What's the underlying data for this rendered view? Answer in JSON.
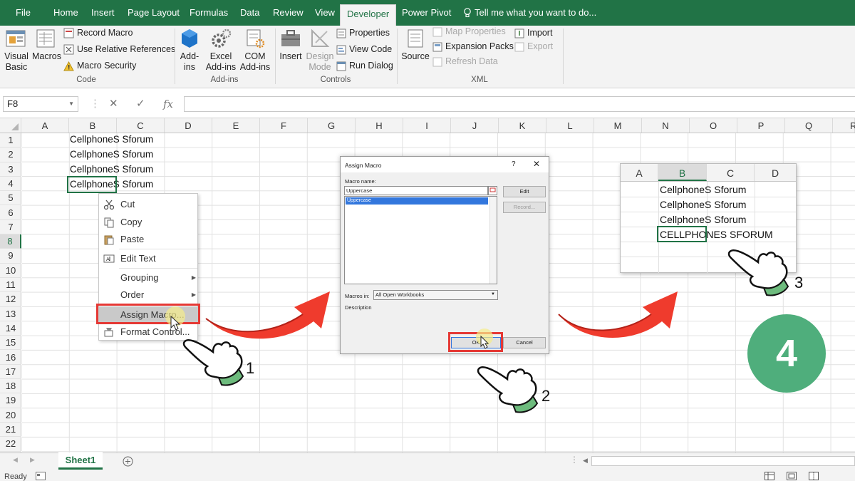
{
  "ribbon": {
    "tabs": [
      "File",
      "Home",
      "Insert",
      "Page Layout",
      "Formulas",
      "Data",
      "Review",
      "View",
      "Developer",
      "Power Pivot"
    ],
    "active_tab": "Developer",
    "tell_me": "Tell me what you want to do...",
    "code": {
      "visual_basic": "Visual Basic",
      "macros": "Macros",
      "record_macro": "Record Macro",
      "use_relative": "Use Relative References",
      "macro_security": "Macro Security",
      "label": "Code"
    },
    "addins": {
      "addins": "Add-ins",
      "excel_addins": "Excel Add-ins",
      "com_addins": "COM Add-ins",
      "label": "Add-ins"
    },
    "controls": {
      "insert": "Insert",
      "design_mode": "Design Mode",
      "properties": "Properties",
      "view_code": "View Code",
      "run_dialog": "Run Dialog",
      "label": "Controls"
    },
    "xml": {
      "source": "Source",
      "map_properties": "Map Properties",
      "expansion_packs": "Expansion Packs",
      "refresh_data": "Refresh Data",
      "import": "Import",
      "export": "Export",
      "label": "XML"
    }
  },
  "formula_bar": {
    "name_box": "F8",
    "fx": "fx"
  },
  "grid": {
    "columns": [
      "A",
      "B",
      "C",
      "D",
      "E",
      "F",
      "G",
      "H",
      "I",
      "J",
      "K",
      "L",
      "M",
      "N",
      "O",
      "P",
      "Q",
      "R"
    ],
    "rows": [
      "1",
      "2",
      "3",
      "4",
      "5",
      "6",
      "7",
      "8",
      "9",
      "10",
      "11",
      "12",
      "13",
      "14",
      "15",
      "16",
      "17",
      "18",
      "19",
      "20",
      "21",
      "22"
    ],
    "b_values": [
      "CellphoneS Sforum",
      "CellphoneS Sforum",
      "CellphoneS Sforum",
      "CellphoneS Sforum"
    ]
  },
  "context_menu": {
    "items": [
      "Cut",
      "Copy",
      "Paste",
      "Edit Text",
      "Grouping",
      "Order",
      "Assign Macro...",
      "Format Control..."
    ]
  },
  "dialog": {
    "title": "Assign Macro",
    "help": "?",
    "close": "✕",
    "macro_name_label": "Macro name:",
    "macro_name_value": "Uppercase",
    "list_items": [
      "Uppercase"
    ],
    "edit": "Edit",
    "record": "Record...",
    "macros_in_label": "Macros in:",
    "macros_in_value": "All Open Workbooks",
    "description_label": "Description",
    "ok": "OK",
    "cancel": "Cancel"
  },
  "result": {
    "columns": [
      "A",
      "B",
      "C",
      "D"
    ],
    "b_values": [
      "CellphoneS Sforum",
      "CellphoneS Sforum",
      "CellphoneS Sforum",
      "CELLPHONES SFORUM"
    ]
  },
  "steps": [
    "1",
    "2",
    "3"
  ],
  "step_badge": "4",
  "sheet_tab": "Sheet1",
  "status": "Ready",
  "colors": {
    "excel_green": "#217346",
    "highlight_red": "#e53935",
    "badge_green": "#4fae7c"
  }
}
